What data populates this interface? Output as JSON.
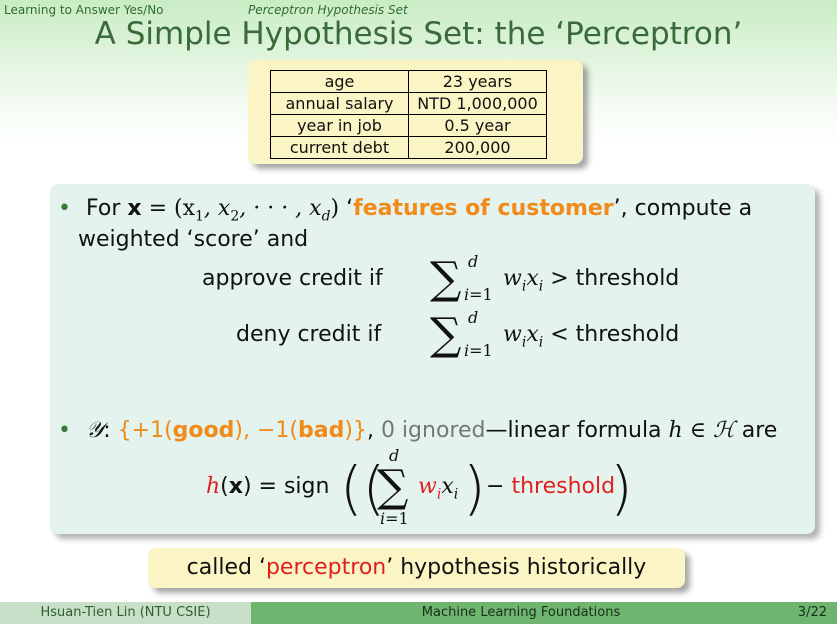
{
  "header": {
    "section": "Learning to Answer Yes/No",
    "subsection": "Perceptron Hypothesis Set"
  },
  "slide_title": "A Simple Hypothesis Set: the ‘Perceptron’",
  "customer_table": [
    {
      "key": "age",
      "value": "23 years"
    },
    {
      "key": "annual salary",
      "value": "NTD 1,000,000"
    },
    {
      "key": "year in job",
      "value": "0.5 year"
    },
    {
      "key": "current debt",
      "value": "200,000"
    }
  ],
  "bullet1": {
    "for": "For",
    "x_bold": "x",
    "eq_tuple": "= (x",
    "tuple_rest": ", x",
    "dots": ", · · · , x",
    "close": ")",
    "quote_open": "‘",
    "features": "features of customer",
    "quote_close": "’, compute a",
    "line2": "weighted ‘score’ and",
    "approve_label": "approve credit if",
    "deny_label": "deny credit if",
    "sum_upper": "d",
    "sum_lower": "i=1",
    "wx": "w",
    "gt": "> threshold",
    "lt": "< threshold"
  },
  "bullet2": {
    "y": "𝒴",
    "colon": ":",
    "set_open": "{+1(",
    "good": "good",
    "mid": "), −1(",
    "bad": "bad",
    "set_close": ")}",
    "comma": ",",
    "ignored": "0 ignored",
    "dash_text": "—linear formula",
    "h_in_H": "h ∈ ℋ",
    "are": "are"
  },
  "formula": {
    "lhs_h": "h",
    "lhs_x": "x",
    "eq_sign": "= sign",
    "sum_upper": "d",
    "sum_lower": "i=1",
    "w": "w",
    "minus": "−",
    "threshold": "threshold"
  },
  "callout": {
    "pre": "called ‘",
    "word": "perceptron",
    "post": "’ hypothesis historically"
  },
  "footer": {
    "author": "Hsuan-Tien Lin  (NTU CSIE)",
    "course": "Machine Learning Foundations",
    "page": "3/22"
  },
  "colors": {
    "accent_orange": "#f08a18",
    "accent_red": "#e0201e",
    "title_green": "#3a6a3a"
  }
}
